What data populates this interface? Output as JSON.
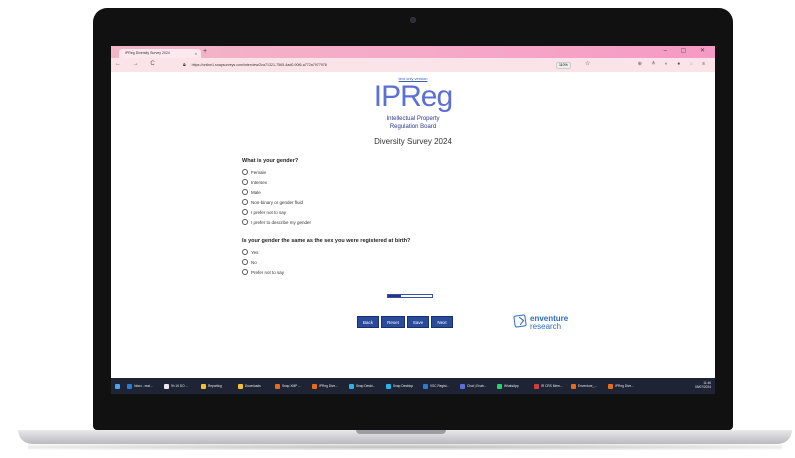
{
  "browser": {
    "tab_title": "IPReg Diversity Survey 2024",
    "tab_close": "×",
    "new_tab": "+",
    "window_controls": "–  ▢  ✕",
    "nav_icons": "← → C",
    "url": "https://online1.snapsurveys.com/interview/2ca71321-7565-4ad0-90f6-a772a7977978",
    "zoom": "110%",
    "bookmark_icon": "star-icon",
    "extensions_icons": "⊕ ≛ ◐ ● ◌ ≡"
  },
  "page": {
    "text_link": "text only version",
    "logo": "IPReg",
    "org_line1": "Intellectual Property",
    "org_line2": "Regulation Board",
    "survey_title": "Diversity Survey 2024"
  },
  "questions": [
    {
      "text": "What is your gender?",
      "options": [
        "Female",
        "Intersex",
        "Male",
        "Non-binary or gender fluid",
        "I prefer not to say",
        "I prefer to describe my gender"
      ]
    },
    {
      "text": "Is your gender the same as the sex you were registered at birth?",
      "options": [
        "Yes",
        "No",
        "Prefer not to say"
      ]
    }
  ],
  "progress": {
    "fraction": 0.3
  },
  "buttons": {
    "back": "Back",
    "reset": "Reset",
    "save": "Save",
    "next": "Next"
  },
  "brand": {
    "line1": "enventure",
    "line2": "research",
    "color": "#2f6cbf"
  },
  "taskbar": {
    "items": [
      {
        "label": "Inbox - mat...",
        "color": "#2b7bd6"
      },
      {
        "label": "9h 16 DO ...",
        "color": "#e8e8ee"
      },
      {
        "label": "Reporting",
        "color": "#f2c12e"
      },
      {
        "label": "Downloads",
        "color": "#f2c12e"
      },
      {
        "label": "Snap XMP ...",
        "color": "#e66b1d"
      },
      {
        "label": "IPReg Dive...",
        "color": "#e66b1d"
      },
      {
        "label": "Snap Deskt...",
        "color": "#2bb3e6"
      },
      {
        "label": "Snap Desktop",
        "color": "#2bb3e6"
      },
      {
        "label": "VSC Regist...",
        "color": "#2b7bd6"
      },
      {
        "label": "Chat | Enab...",
        "color": "#5b6fd6"
      },
      {
        "label": "WhatsApp",
        "color": "#25d366"
      },
      {
        "label": "IR CRS Mem...",
        "color": "#d63b3b"
      },
      {
        "label": "Enventure_...",
        "color": "#e66b1d"
      },
      {
        "label": "IPReg Dive...",
        "color": "#e66b1d"
      }
    ],
    "time": "11:46",
    "date": "05/07/2024"
  },
  "colors": {
    "accent": "#2a4a9a",
    "logo": "#5b6fd6",
    "tabbar": "#f6a7c8"
  }
}
